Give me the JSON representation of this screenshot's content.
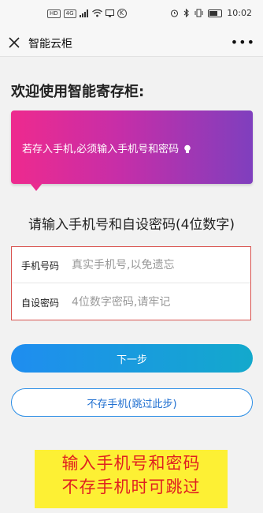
{
  "status_bar": {
    "left_chip": "HD",
    "signal_chip": "4G",
    "circle_icon_label": "K",
    "time": "10:02"
  },
  "nav": {
    "title": "智能云柜",
    "more_label": "•••"
  },
  "welcome": "欢迎使用智能寄存柜:",
  "banner": {
    "text": "若存入手机,必须输入手机号和密码",
    "colors": {
      "start": "#ee2a8e",
      "end": "#7f3fbe"
    }
  },
  "subtitle": "请输入手机号和自设密码(4位数字)",
  "form": {
    "phone": {
      "label": "手机号码",
      "placeholder": "真实手机号,以免遗忘",
      "value": ""
    },
    "password": {
      "label": "自设密码",
      "placeholder": "4位数字密码,请牢记",
      "value": ""
    }
  },
  "buttons": {
    "next": "下一步",
    "skip": "不存手机(跳过此步)"
  },
  "note": {
    "line1": "输入手机号和密码",
    "line2": "不存手机时可跳过"
  },
  "icons": [
    "close-icon",
    "more-icon",
    "bulb-icon",
    "wifi-icon",
    "bluetooth-icon",
    "alarm-icon",
    "battery-icon"
  ]
}
